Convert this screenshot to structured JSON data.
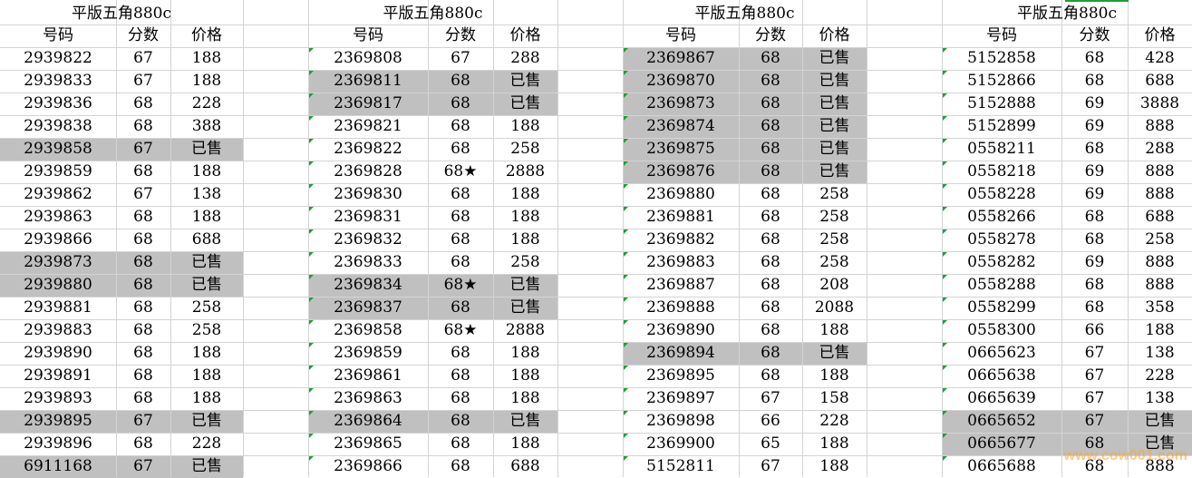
{
  "sheet": {
    "sections": [
      {
        "title": "平版五角880c",
        "headers": [
          "号码",
          "分数",
          "价格"
        ],
        "rows": [
          {
            "number": "2939822",
            "score": "67",
            "price": "188",
            "sold": false
          },
          {
            "number": "2939833",
            "score": "67",
            "price": "188",
            "sold": false
          },
          {
            "number": "2939836",
            "score": "68",
            "price": "228",
            "sold": false
          },
          {
            "number": "2939838",
            "score": "68",
            "price": "388",
            "sold": false
          },
          {
            "number": "2939858",
            "score": "67",
            "price": "已售",
            "sold": true
          },
          {
            "number": "2939859",
            "score": "68",
            "price": "188",
            "sold": false
          },
          {
            "number": "2939862",
            "score": "67",
            "price": "138",
            "sold": false
          },
          {
            "number": "2939863",
            "score": "68",
            "price": "188",
            "sold": false
          },
          {
            "number": "2939866",
            "score": "68",
            "price": "688",
            "sold": false
          },
          {
            "number": "2939873",
            "score": "68",
            "price": "已售",
            "sold": true
          },
          {
            "number": "2939880",
            "score": "68",
            "price": "已售",
            "sold": true
          },
          {
            "number": "2939881",
            "score": "68",
            "price": "258",
            "sold": false
          },
          {
            "number": "2939883",
            "score": "68",
            "price": "258",
            "sold": false
          },
          {
            "number": "2939890",
            "score": "68",
            "price": "188",
            "sold": false
          },
          {
            "number": "2939891",
            "score": "68",
            "price": "188",
            "sold": false
          },
          {
            "number": "2939893",
            "score": "68",
            "price": "188",
            "sold": false
          },
          {
            "number": "2939895",
            "score": "67",
            "price": "已售",
            "sold": true
          },
          {
            "number": "2939896",
            "score": "68",
            "price": "228",
            "sold": false
          },
          {
            "number": "6911168",
            "score": "67",
            "price": "已售",
            "sold": true
          }
        ]
      },
      {
        "title": "平版五角880c",
        "headers": [
          "号码",
          "分数",
          "价格"
        ],
        "rows": [
          {
            "number": "2369808",
            "score": "67",
            "price": "288",
            "sold": false
          },
          {
            "number": "2369811",
            "score": "68",
            "price": "已售",
            "sold": true
          },
          {
            "number": "2369817",
            "score": "68",
            "price": "已售",
            "sold": true
          },
          {
            "number": "2369821",
            "score": "68",
            "price": "188",
            "sold": false
          },
          {
            "number": "2369822",
            "score": "68",
            "price": "258",
            "sold": false
          },
          {
            "number": "2369828",
            "score": "68★",
            "price": "2888",
            "sold": false
          },
          {
            "number": "2369830",
            "score": "68",
            "price": "188",
            "sold": false
          },
          {
            "number": "2369831",
            "score": "68",
            "price": "188",
            "sold": false
          },
          {
            "number": "2369832",
            "score": "68",
            "price": "188",
            "sold": false
          },
          {
            "number": "2369833",
            "score": "68",
            "price": "258",
            "sold": false
          },
          {
            "number": "2369834",
            "score": "68★",
            "price": "已售",
            "sold": true
          },
          {
            "number": "2369837",
            "score": "68",
            "price": "已售",
            "sold": true
          },
          {
            "number": "2369858",
            "score": "68★",
            "price": "2888",
            "sold": false
          },
          {
            "number": "2369859",
            "score": "68",
            "price": "188",
            "sold": false
          },
          {
            "number": "2369861",
            "score": "68",
            "price": "188",
            "sold": false
          },
          {
            "number": "2369863",
            "score": "68",
            "price": "188",
            "sold": false
          },
          {
            "number": "2369864",
            "score": "68",
            "price": "已售",
            "sold": true
          },
          {
            "number": "2369865",
            "score": "68",
            "price": "188",
            "sold": false
          },
          {
            "number": "2369866",
            "score": "68",
            "price": "688",
            "sold": false
          }
        ]
      },
      {
        "title": "平版五角880c",
        "headers": [
          "号码",
          "分数",
          "价格"
        ],
        "rows": [
          {
            "number": "2369867",
            "score": "68",
            "price": "已售",
            "sold": true
          },
          {
            "number": "2369870",
            "score": "68",
            "price": "已售",
            "sold": true
          },
          {
            "number": "2369873",
            "score": "68",
            "price": "已售",
            "sold": true
          },
          {
            "number": "2369874",
            "score": "68",
            "price": "已售",
            "sold": true
          },
          {
            "number": "2369875",
            "score": "68",
            "price": "已售",
            "sold": true
          },
          {
            "number": "2369876",
            "score": "68",
            "price": "已售",
            "sold": true
          },
          {
            "number": "2369880",
            "score": "68",
            "price": "258",
            "sold": false
          },
          {
            "number": "2369881",
            "score": "68",
            "price": "258",
            "sold": false
          },
          {
            "number": "2369882",
            "score": "68",
            "price": "258",
            "sold": false
          },
          {
            "number": "2369883",
            "score": "68",
            "price": "258",
            "sold": false
          },
          {
            "number": "2369887",
            "score": "68",
            "price": "208",
            "sold": false
          },
          {
            "number": "2369888",
            "score": "68",
            "price": "2088",
            "sold": false
          },
          {
            "number": "2369890",
            "score": "68",
            "price": "188",
            "sold": false
          },
          {
            "number": "2369894",
            "score": "68",
            "price": "已售",
            "sold": true
          },
          {
            "number": "2369895",
            "score": "68",
            "price": "188",
            "sold": false
          },
          {
            "number": "2369897",
            "score": "67",
            "price": "158",
            "sold": false
          },
          {
            "number": "2369898",
            "score": "66",
            "price": "228",
            "sold": false
          },
          {
            "number": "2369900",
            "score": "65",
            "price": "188",
            "sold": false
          },
          {
            "number": "5152811",
            "score": "67",
            "price": "188",
            "sold": false
          }
        ]
      },
      {
        "title": "平版五角880c",
        "headers": [
          "号码",
          "分数",
          "价格"
        ],
        "rows": [
          {
            "number": "5152858",
            "score": "68",
            "price": "428",
            "sold": false
          },
          {
            "number": "5152866",
            "score": "68",
            "price": "688",
            "sold": false
          },
          {
            "number": "5152888",
            "score": "69",
            "price": "3888",
            "sold": false
          },
          {
            "number": "5152899",
            "score": "69",
            "price": "888",
            "sold": false
          },
          {
            "number": "0558211",
            "score": "68",
            "price": "288",
            "sold": false
          },
          {
            "number": "0558218",
            "score": "69",
            "price": "888",
            "sold": false
          },
          {
            "number": "0558228",
            "score": "69",
            "price": "888",
            "sold": false
          },
          {
            "number": "0558266",
            "score": "68",
            "price": "688",
            "sold": false
          },
          {
            "number": "0558278",
            "score": "68",
            "price": "258",
            "sold": false
          },
          {
            "number": "0558282",
            "score": "69",
            "price": "888",
            "sold": false
          },
          {
            "number": "0558288",
            "score": "68",
            "price": "888",
            "sold": false
          },
          {
            "number": "0558299",
            "score": "68",
            "price": "358",
            "sold": false
          },
          {
            "number": "0558300",
            "score": "66",
            "price": "188",
            "sold": false
          },
          {
            "number": "0665623",
            "score": "67",
            "price": "138",
            "sold": false
          },
          {
            "number": "0665638",
            "score": "67",
            "price": "228",
            "sold": false
          },
          {
            "number": "0665639",
            "score": "67",
            "price": "138",
            "sold": false
          },
          {
            "number": "0665652",
            "score": "67",
            "price": "已售",
            "sold": true
          },
          {
            "number": "0665677",
            "score": "68",
            "price": "已售",
            "sold": true
          },
          {
            "number": "0665688",
            "score": "68",
            "price": "888",
            "sold": false
          }
        ]
      }
    ],
    "watermark": "www.cow001.com",
    "colors": {
      "sold_fill": "#c0c0c0",
      "grid": "#d4d4d4",
      "marker": "#1e9e3a"
    }
  }
}
